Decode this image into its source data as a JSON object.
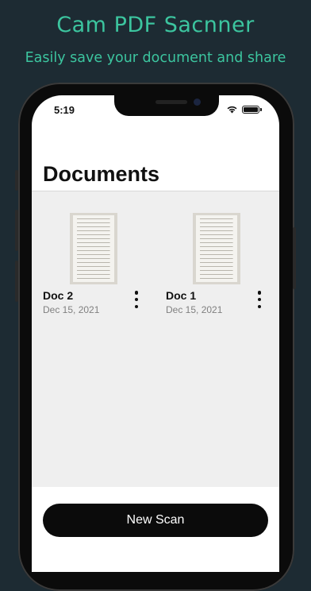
{
  "promo": {
    "title": "Cam PDF Sacnner",
    "subtitle": "Easily save your document and share"
  },
  "status_bar": {
    "time": "5:19",
    "icons": [
      "wifi-icon",
      "battery-icon"
    ]
  },
  "header": {
    "title": "Documents"
  },
  "documents": [
    {
      "name": "Doc 2",
      "date": "Dec 15, 2021",
      "menu_icon": "more-vertical-icon"
    },
    {
      "name": "Doc 1",
      "date": "Dec 15, 2021",
      "menu_icon": "more-vertical-icon"
    }
  ],
  "actions": {
    "new_scan_label": "New Scan"
  },
  "colors": {
    "background": "#1d2b33",
    "accent": "#3cc59f",
    "button": "#0b0b0b",
    "list_background": "#efefef"
  }
}
